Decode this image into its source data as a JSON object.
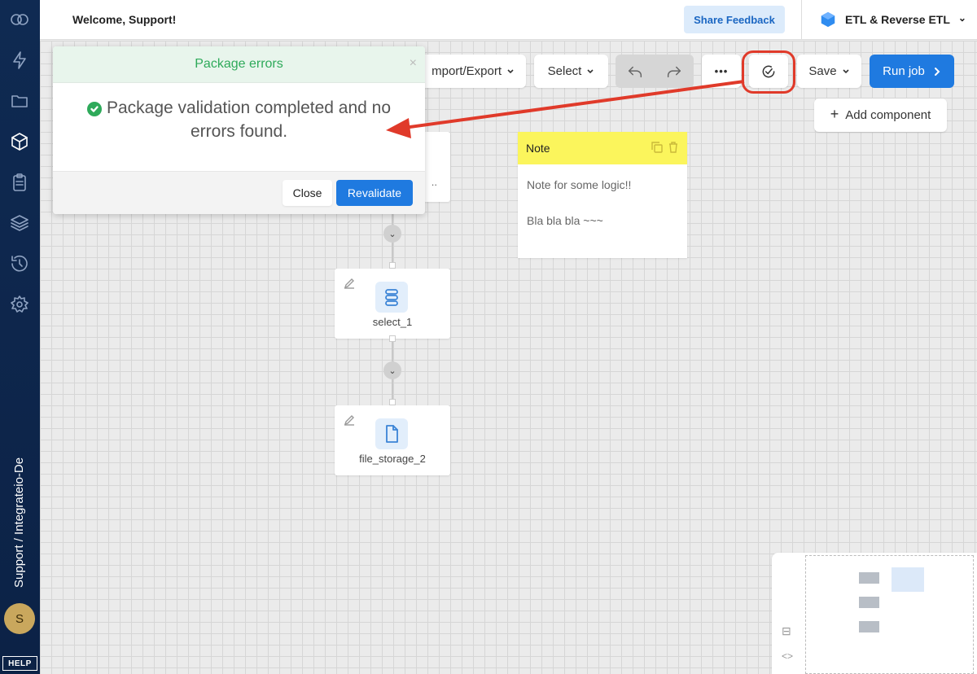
{
  "sidebar": {
    "icons": [
      {
        "name": "logo-icon"
      },
      {
        "name": "lightning-icon"
      },
      {
        "name": "folder-icon"
      },
      {
        "name": "package-icon"
      },
      {
        "name": "clipboard-icon"
      },
      {
        "name": "layers-icon"
      },
      {
        "name": "history-icon"
      },
      {
        "name": "gear-icon"
      }
    ],
    "workspace_label": "Support / Integrateio-De",
    "avatar_initial": "S",
    "help_label": "HELP"
  },
  "header": {
    "welcome": "Welcome, Support!",
    "share_feedback": "Share Feedback",
    "product_name": "ETL & Reverse ETL",
    "product_chevron": "⌄"
  },
  "toolbar": {
    "import_export": "mport/Export",
    "select": "Select",
    "more": "•••",
    "save": "Save",
    "run_job": "Run job",
    "add_component": "Add component"
  },
  "modal": {
    "title": "Package errors",
    "close_x": "×",
    "message": "Package validation completed and no errors found.",
    "close_button": "Close",
    "revalidate_button": "Revalidate"
  },
  "nodes": [
    {
      "label": "select_1",
      "icon": "select-icon"
    },
    {
      "label": "file_storage_2",
      "icon": "file-icon"
    }
  ],
  "hidden_node_suffix": "..",
  "note": {
    "title": "Note",
    "lines": [
      "Note for some logic!!",
      "Bla bla bla ~~~"
    ]
  },
  "colors": {
    "sidebar": "#0f2a52",
    "primary": "#1f7ae0",
    "success": "#2eaa5a",
    "annotation": "#e03a2a",
    "note_header": "#fbf55c"
  }
}
